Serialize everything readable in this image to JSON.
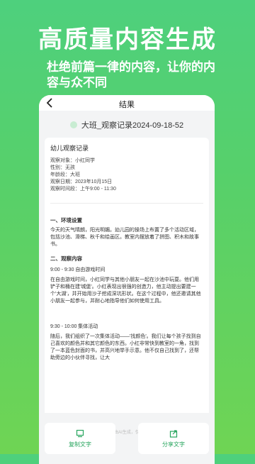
{
  "hero": {
    "title": "高质量内容生成",
    "subtitle": "杜绝前篇一律的内容，让你的内容与众不同"
  },
  "app": {
    "title": "结果",
    "record_name": "大班_观察记录2024-09-18-52",
    "card": {
      "title": "幼儿观察记录",
      "info": [
        "观察对象：小红同学",
        "性别：无孩",
        "年龄段：大班",
        "观察日期：2023年10月15日",
        "观察时间段：上午9:00 - 11:30"
      ],
      "sections": [
        "一、环境设置",
        "今天的天气晴朗，阳光明媚。幼儿园的操场上布置了多个活动区域，包括沙池、滑梯、秋千和绘画区。教室内摆放着了拼图、积木和故事书。",
        "二、观察内容",
        "9:00 - 9:30 自由游戏时间",
        "在自由游戏时间，小红同学与其他小朋友一起在沙池中玩耍。他们用铲子和桶在建'城堡'。小红表现出很强的创造力，他主动提出要建一个'大湖'，并开始用沙子挖成深坑形状。在这个过程中，他还邀请其他小朋友一起参与，并耐心地指导他们如何使用工具。",
        "9:30 - 10:00 集体活动",
        "随后，我们组织了一次集体活动——'找颜色'。我们让每个孩子找到自己喜欢的颜色并和其它颜色的东西。小红非常快到教室的一角，找到了一本蓝色封面的书，并高兴地举手示意。他不仅自己找到了，还帮助旁边的小伙伴寻找，让大"
      ]
    },
    "watermark": "本内容由AI生成，仅供参考",
    "actions": {
      "copy_label": "复制文字",
      "share_label": "分享文字"
    }
  },
  "colors": {
    "brand_green": "#27a55e",
    "background_gradient_top": "#4ed07d",
    "background_gradient_bottom": "#6fd454"
  }
}
